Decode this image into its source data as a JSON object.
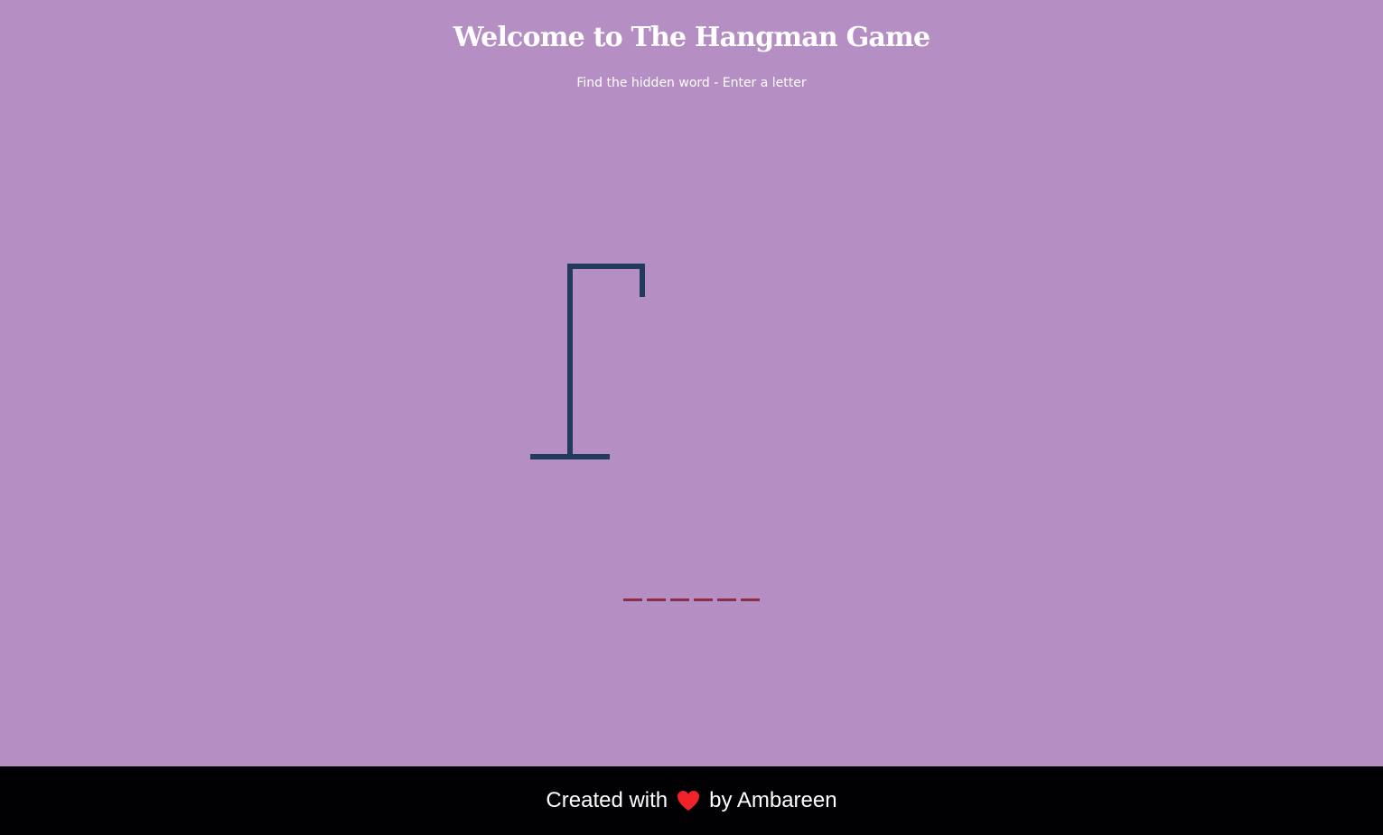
{
  "header": {
    "title": "Welcome to The Hangman Game",
    "subtitle": "Find the hidden word - Enter a letter"
  },
  "game": {
    "word_length": 6,
    "revealed_letters": [
      "",
      "",
      "",
      "",
      "",
      ""
    ],
    "gallows_color": "#223a5e",
    "blank_color": "#8b2d45"
  },
  "footer": {
    "prefix": "Created with",
    "icon": "heart-icon",
    "suffix": "by Ambareen",
    "heart_color": "#f0222a"
  },
  "colors": {
    "background": "#b58fc3",
    "footer_background": "#010104",
    "text": "#ffffff"
  }
}
